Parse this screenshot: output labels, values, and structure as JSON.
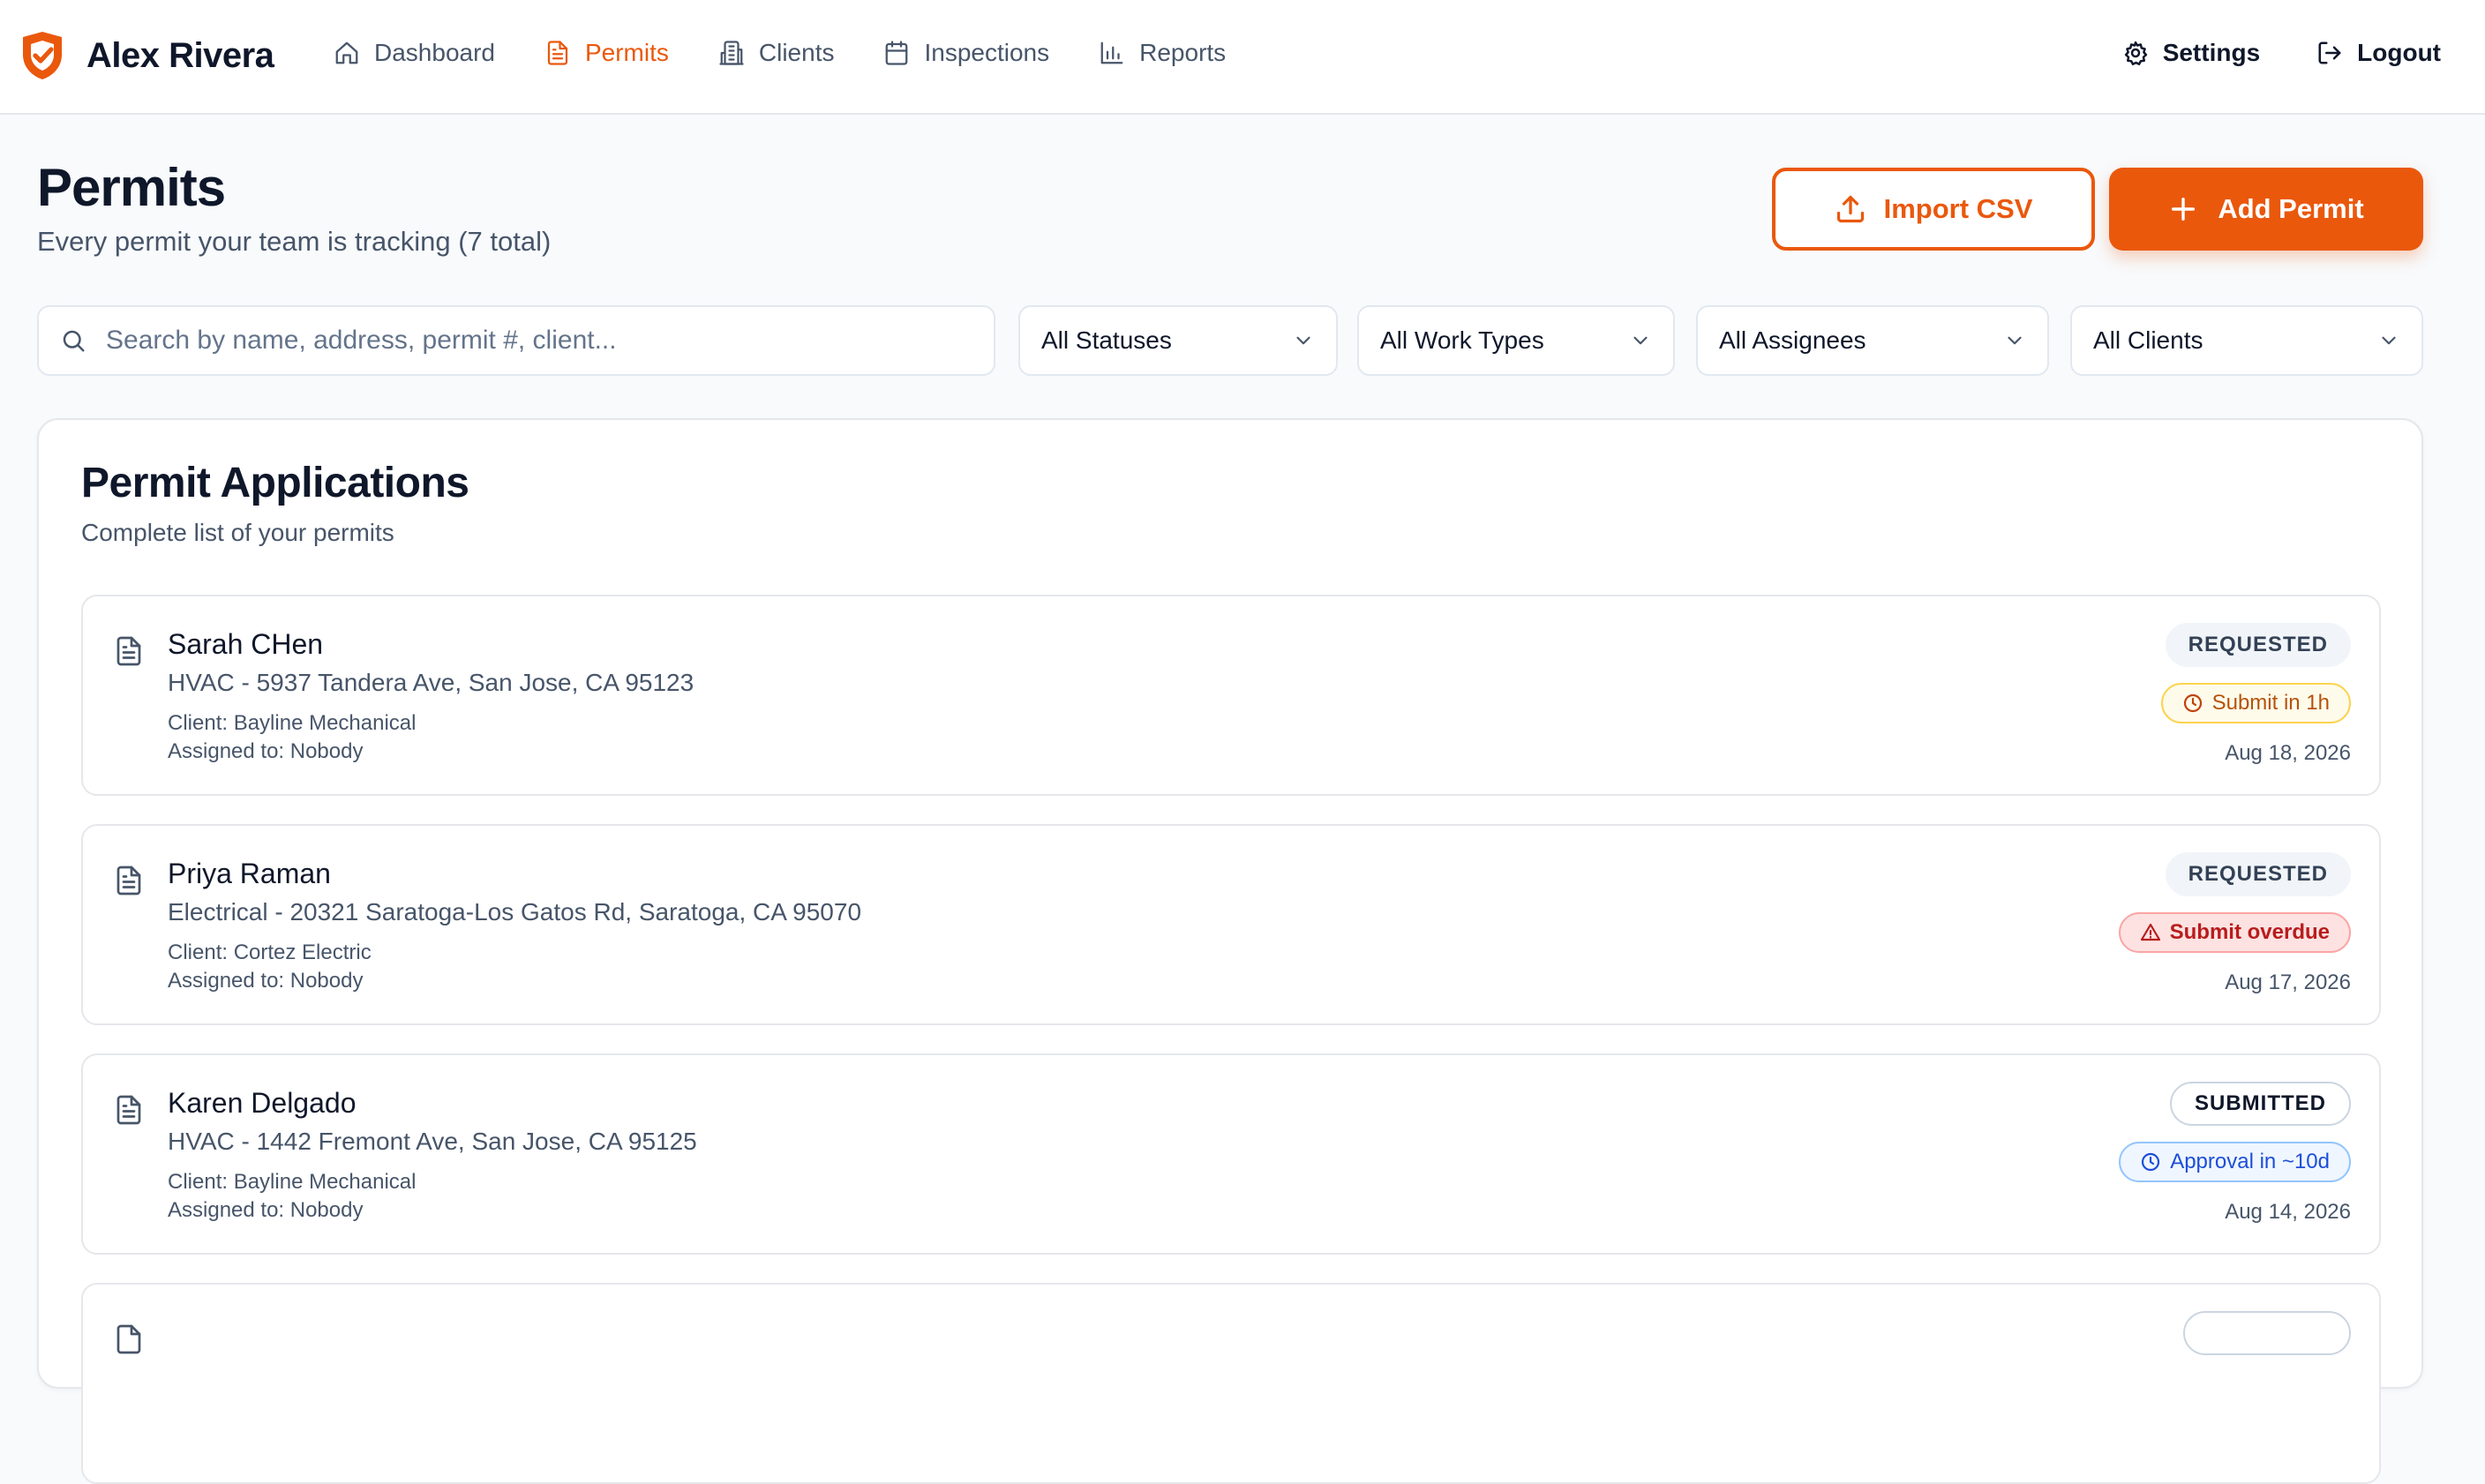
{
  "header": {
    "user_name": "Alex Rivera",
    "nav": [
      {
        "label": "Dashboard",
        "icon": "home-icon"
      },
      {
        "label": "Permits",
        "icon": "document-icon",
        "active": true
      },
      {
        "label": "Clients",
        "icon": "building-icon"
      },
      {
        "label": "Inspections",
        "icon": "calendar-icon"
      },
      {
        "label": "Reports",
        "icon": "bar-chart-icon"
      }
    ],
    "settings_label": "Settings",
    "logout_label": "Logout"
  },
  "page": {
    "title": "Permits",
    "subtitle": "Every permit your team is tracking (7 total)",
    "import_label": "Import CSV",
    "add_label": "Add Permit"
  },
  "filters": {
    "search_placeholder": "Search by name, address, permit #, client...",
    "status": "All Statuses",
    "work_type": "All Work Types",
    "assignee": "All Assignees",
    "client": "All Clients"
  },
  "panel": {
    "title": "Permit Applications",
    "subtitle": "Complete list of your permits"
  },
  "permits": [
    {
      "name": "Sarah CHen",
      "address": "HVAC - 5937 Tandera Ave, San Jose, CA 95123",
      "client": "Client: Bayline Mechanical",
      "assigned": "Assigned to: Nobody",
      "status": "REQUESTED",
      "eta": "Submit in 1h",
      "date": "Aug 18, 2026"
    },
    {
      "name": "Priya Raman",
      "address": "Electrical - 20321 Saratoga-Los Gatos Rd, Saratoga, CA 95070",
      "client": "Client: Cortez Electric",
      "assigned": "Assigned to: Nobody",
      "status": "REQUESTED",
      "eta": "Submit overdue",
      "date": "Aug 17, 2026"
    },
    {
      "name": "Karen Delgado",
      "address": "HVAC - 1442 Fremont Ave, San Jose, CA 95125",
      "client": "Client: Bayline Mechanical",
      "assigned": "Assigned to: Nobody",
      "status": "SUBMITTED",
      "eta": "Approval in ~10d",
      "date": "Aug 14, 2026"
    }
  ],
  "colors": {
    "accent": "#ea580c",
    "text": "#0f172a",
    "muted": "#475569",
    "border": "#e5e7eb",
    "background": "#f8fafc"
  }
}
